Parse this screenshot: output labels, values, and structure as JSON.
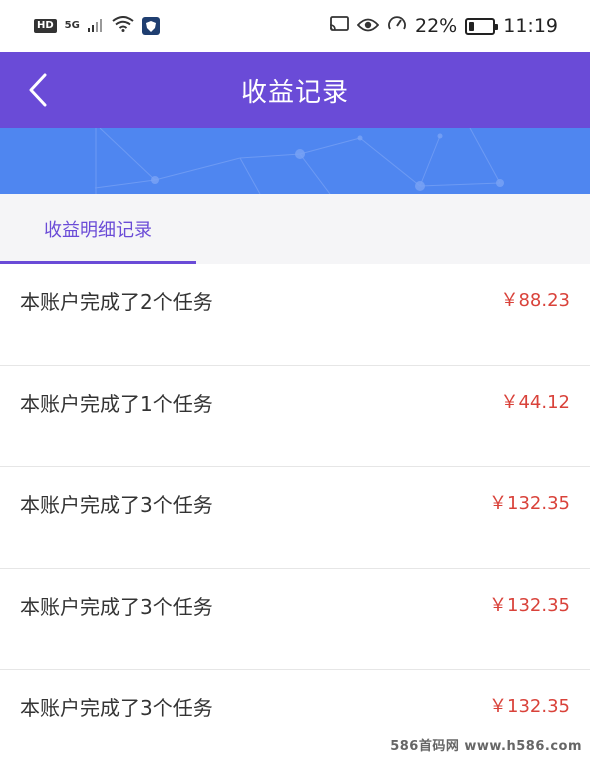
{
  "status_bar": {
    "hd": "HD",
    "network": "5G",
    "battery": "22%",
    "battery_level": 0.22,
    "time": "11:19",
    "icons": [
      "signal-icon",
      "wifi-icon",
      "app-shield-icon",
      "cast-icon",
      "eye-icon",
      "speed-icon",
      "battery-icon"
    ]
  },
  "header": {
    "title": "收益记录",
    "back_icon": "chevron-left-icon",
    "color": "#6a4bd7"
  },
  "banner": {
    "color": "#4f86f0"
  },
  "tabs": [
    {
      "label": "收益明细记录",
      "active": true
    }
  ],
  "records": [
    {
      "title": "本账户完成了2个任务",
      "amount": "￥88.23"
    },
    {
      "title": "本账户完成了1个任务",
      "amount": "￥44.12"
    },
    {
      "title": "本账户完成了3个任务",
      "amount": "￥132.35"
    },
    {
      "title": "本账户完成了3个任务",
      "amount": "￥132.35"
    },
    {
      "title": "本账户完成了3个任务",
      "amount": "￥132.35"
    }
  ],
  "amount_color": "#d9423a",
  "watermark": "586首码网 www.h586.com"
}
